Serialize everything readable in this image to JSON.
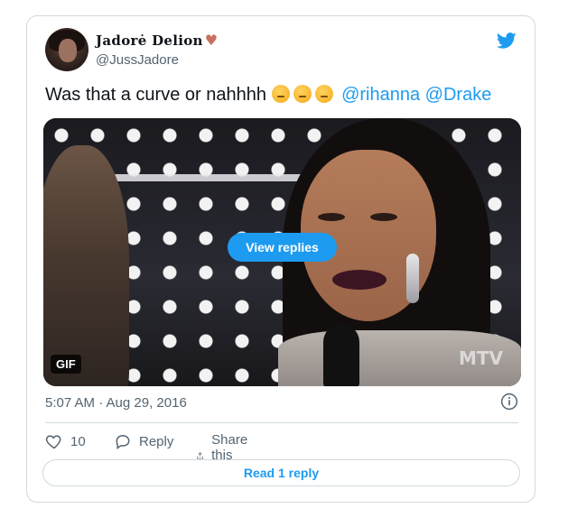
{
  "tweet": {
    "author_name": "Jadorė Delion",
    "author_emoji": "♥",
    "handle": "@JussJadore",
    "text_plain": "Was that a curve or nahhhh",
    "mentions": [
      "@rihanna",
      "@Drake"
    ],
    "emoji_count": 3,
    "timestamp": "5:07 AM · Aug 29, 2016"
  },
  "media": {
    "view_replies_label": "View replies",
    "gif_badge": "GIF",
    "watermark": "MTV"
  },
  "actions": {
    "like_count": "10",
    "reply_label": "Reply",
    "share_label": "Share this Tweet"
  },
  "footer": {
    "read_reply_label": "Read 1 reply"
  },
  "colors": {
    "accent": "#1d9bf0",
    "text": "#0f1419",
    "muted": "#536471",
    "border": "#cfd9de"
  },
  "icons": {
    "brand": "twitter-bird-icon",
    "info": "info-icon",
    "like": "heart-icon",
    "reply": "reply-bubble-icon",
    "share": "share-icon"
  }
}
